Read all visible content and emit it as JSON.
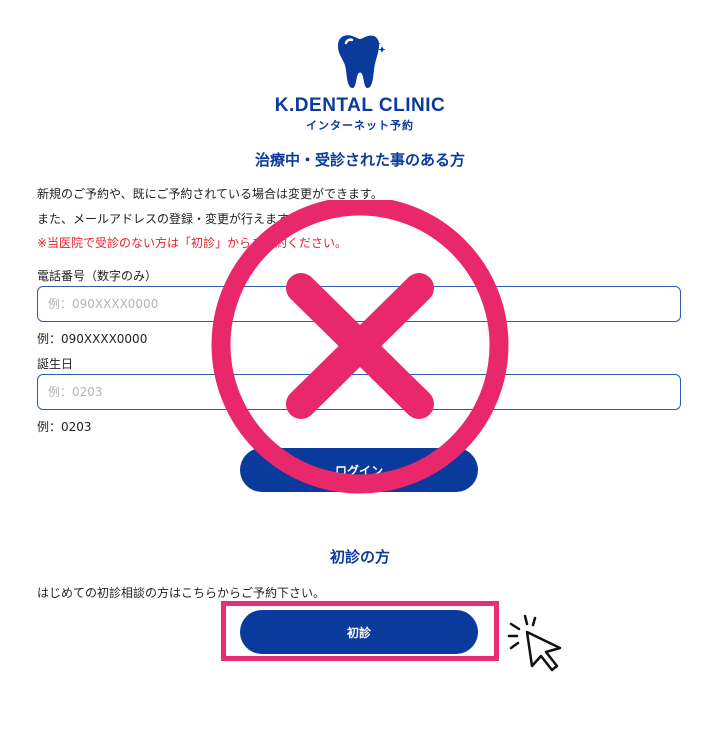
{
  "header": {
    "clinic_name": "K.DENTAL CLINIC",
    "subtitle": "インターネット予約"
  },
  "returning": {
    "title": "治療中・受診された事のある方",
    "line1": "新規のご予約や、既にご予約されている場合は変更ができます。",
    "line2": "また、メールアドレスの登録・変更が行えます。",
    "notice": "※当医院で受診のない方は「初診」からご予約ください。",
    "phone_label": "電話番号（数字のみ）",
    "phone_placeholder": "例：090XXXX0000",
    "phone_example": "例：090XXXX0000",
    "birthday_label": "誕生日",
    "birthday_placeholder": "例：0203",
    "birthday_example": "例：0203",
    "login_label": "ログイン"
  },
  "first_visit": {
    "title": "初診の方",
    "description": "はじめての初診相談の方はこちらからご予約下さい。",
    "button_label": "初診"
  },
  "colors": {
    "brand_blue": "#0a3b9c",
    "notice_red": "#e8202a",
    "overlay_pink": "#e8286a",
    "highlight_pink": "#e82e75"
  },
  "icons": {
    "logo": "tooth-icon",
    "overlay": "cross-circle-icon",
    "cursor": "click-pointer-icon"
  }
}
